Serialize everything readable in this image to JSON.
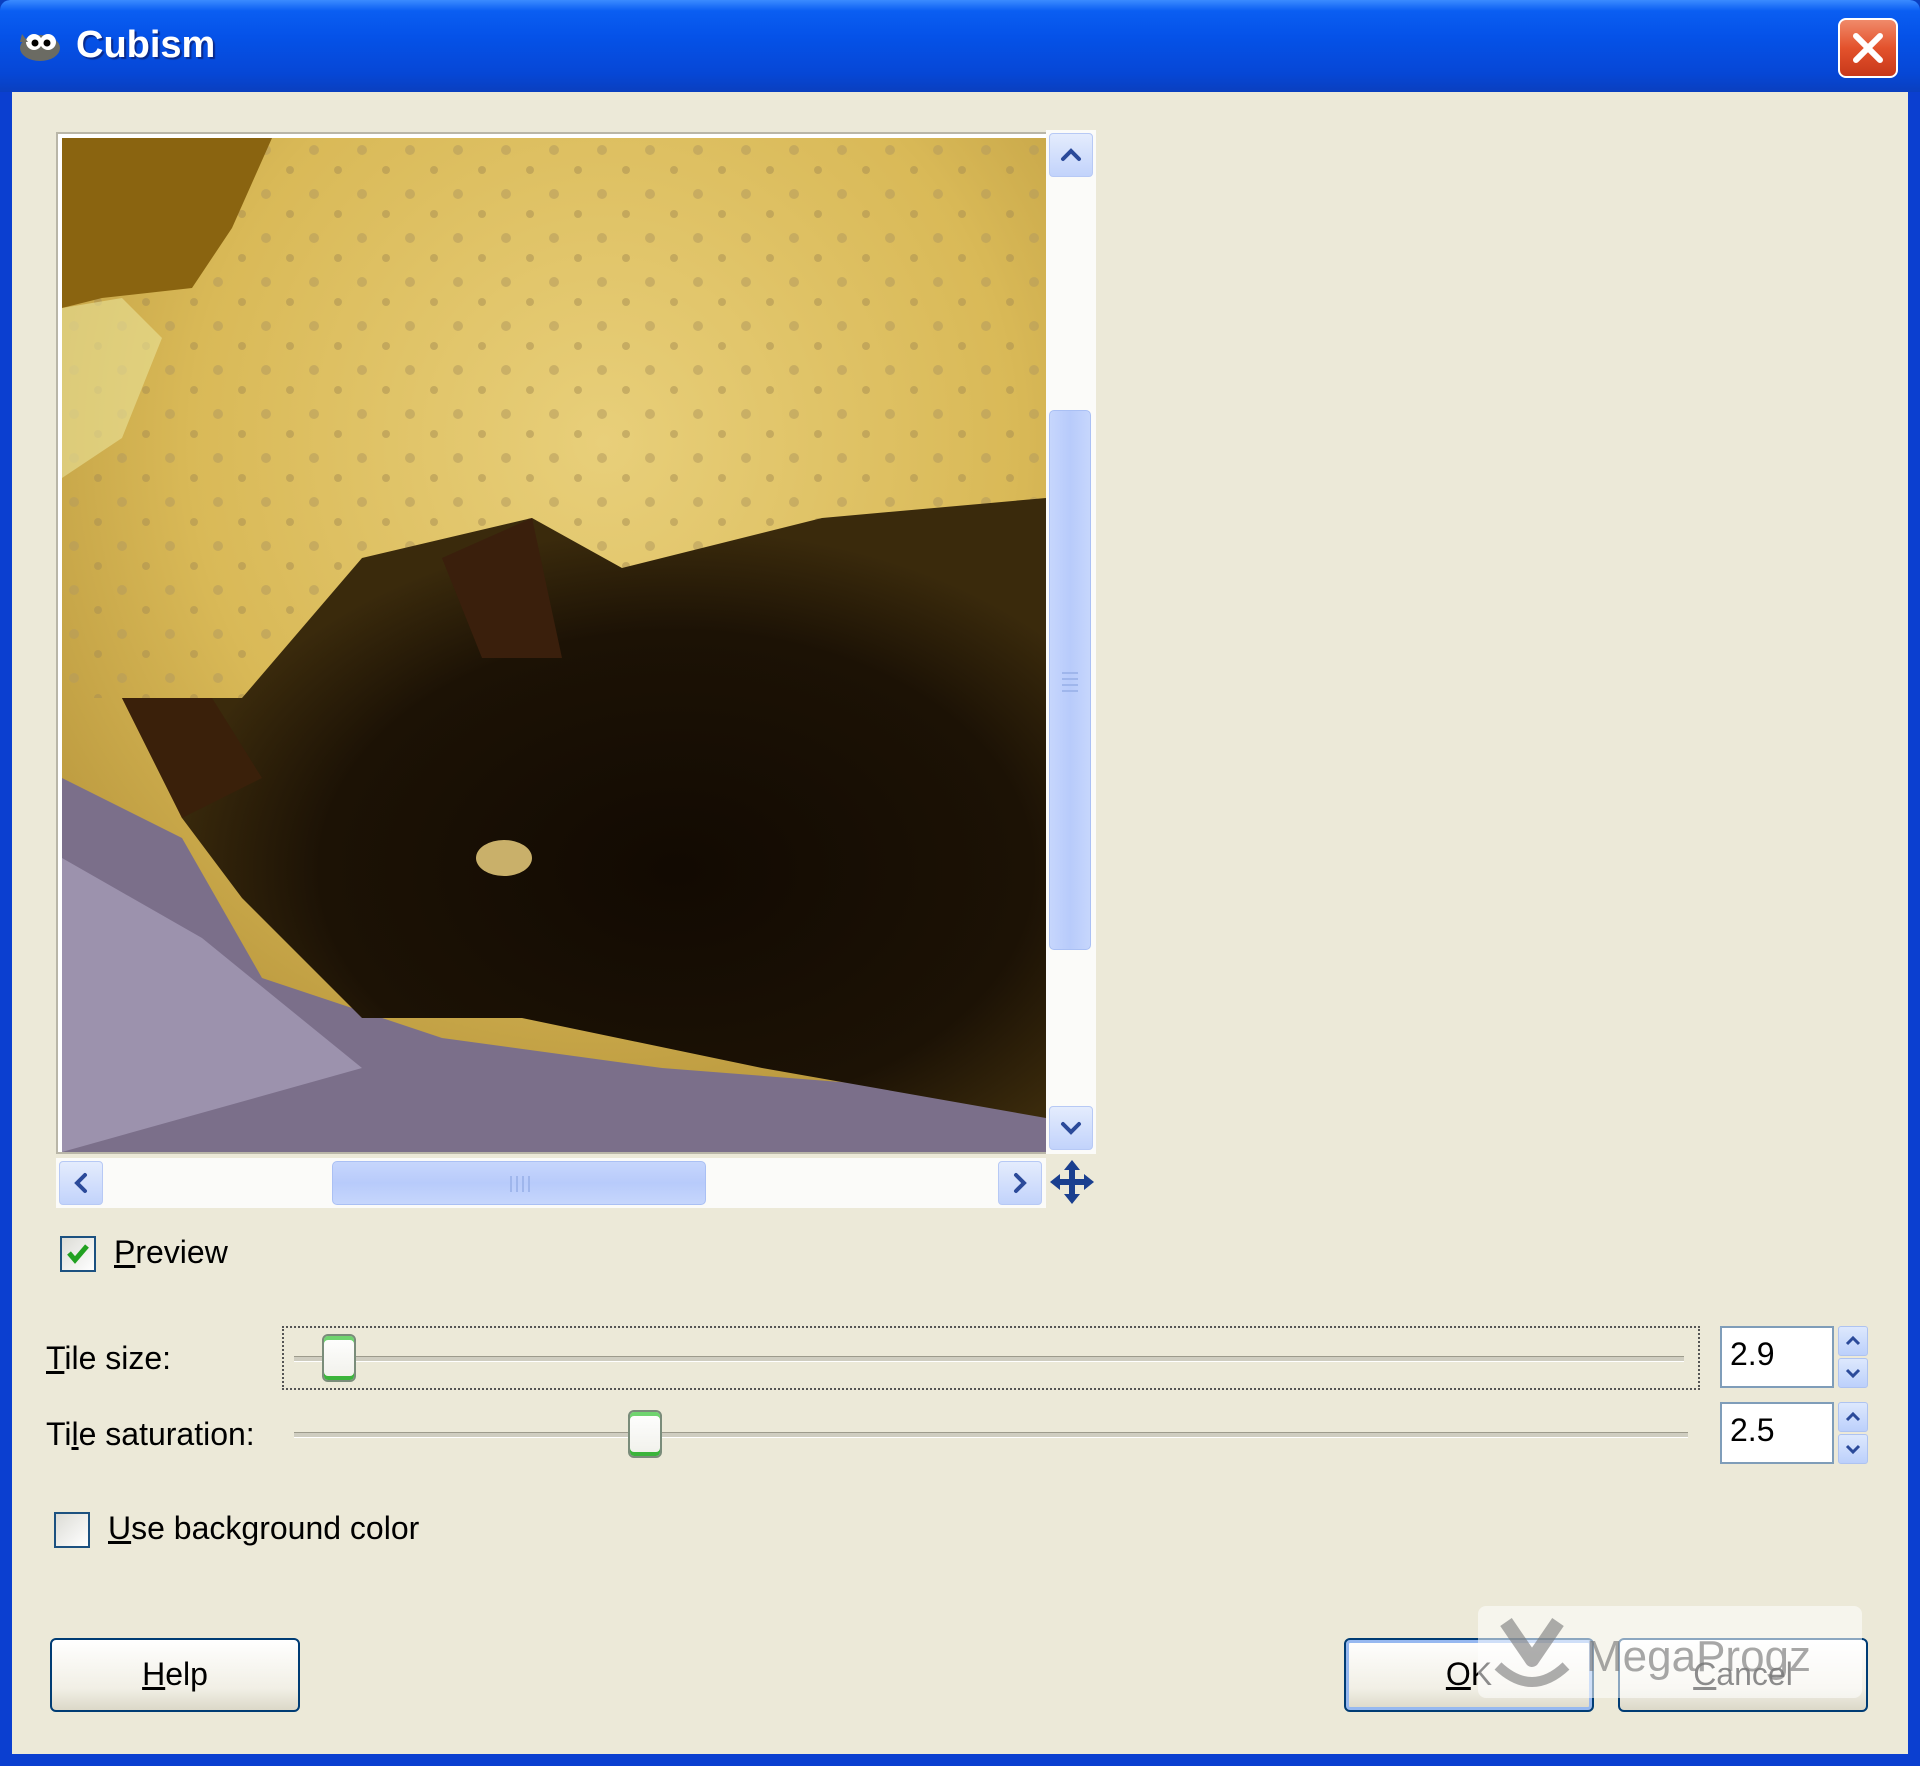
{
  "window": {
    "title": "Cubism",
    "app_icon": "gimp-wilber-icon",
    "close_icon": "close-icon"
  },
  "preview": {
    "image_alt": "cubism-filtered-cat-photo",
    "checkbox_label_mnemonic": "P",
    "checkbox_label_rest": "review",
    "checked": true
  },
  "tile_size": {
    "label_mnemonic": "T",
    "label_rest": "ile size:",
    "value": "2.9"
  },
  "tile_saturation": {
    "label_pre": "Ti",
    "label_mnemonic": "l",
    "label_rest": "e saturation:",
    "value": "2.5"
  },
  "use_background": {
    "label_mnemonic": "U",
    "label_rest": "se background color",
    "checked": false
  },
  "buttons": {
    "help_mnemonic": "H",
    "help_rest": "elp",
    "ok_mnemonic": "O",
    "ok_rest": "K",
    "cancel_mnemonic": "C",
    "cancel_rest": "ancel"
  },
  "watermark": {
    "text": "MegaProgz"
  },
  "colors": {
    "title_bar": "#0552e8",
    "dialog_bg": "#ece9d8",
    "scroll_thumb": "#b8cbfb",
    "check_green": "#21a121",
    "close_red": "#e3522c"
  }
}
